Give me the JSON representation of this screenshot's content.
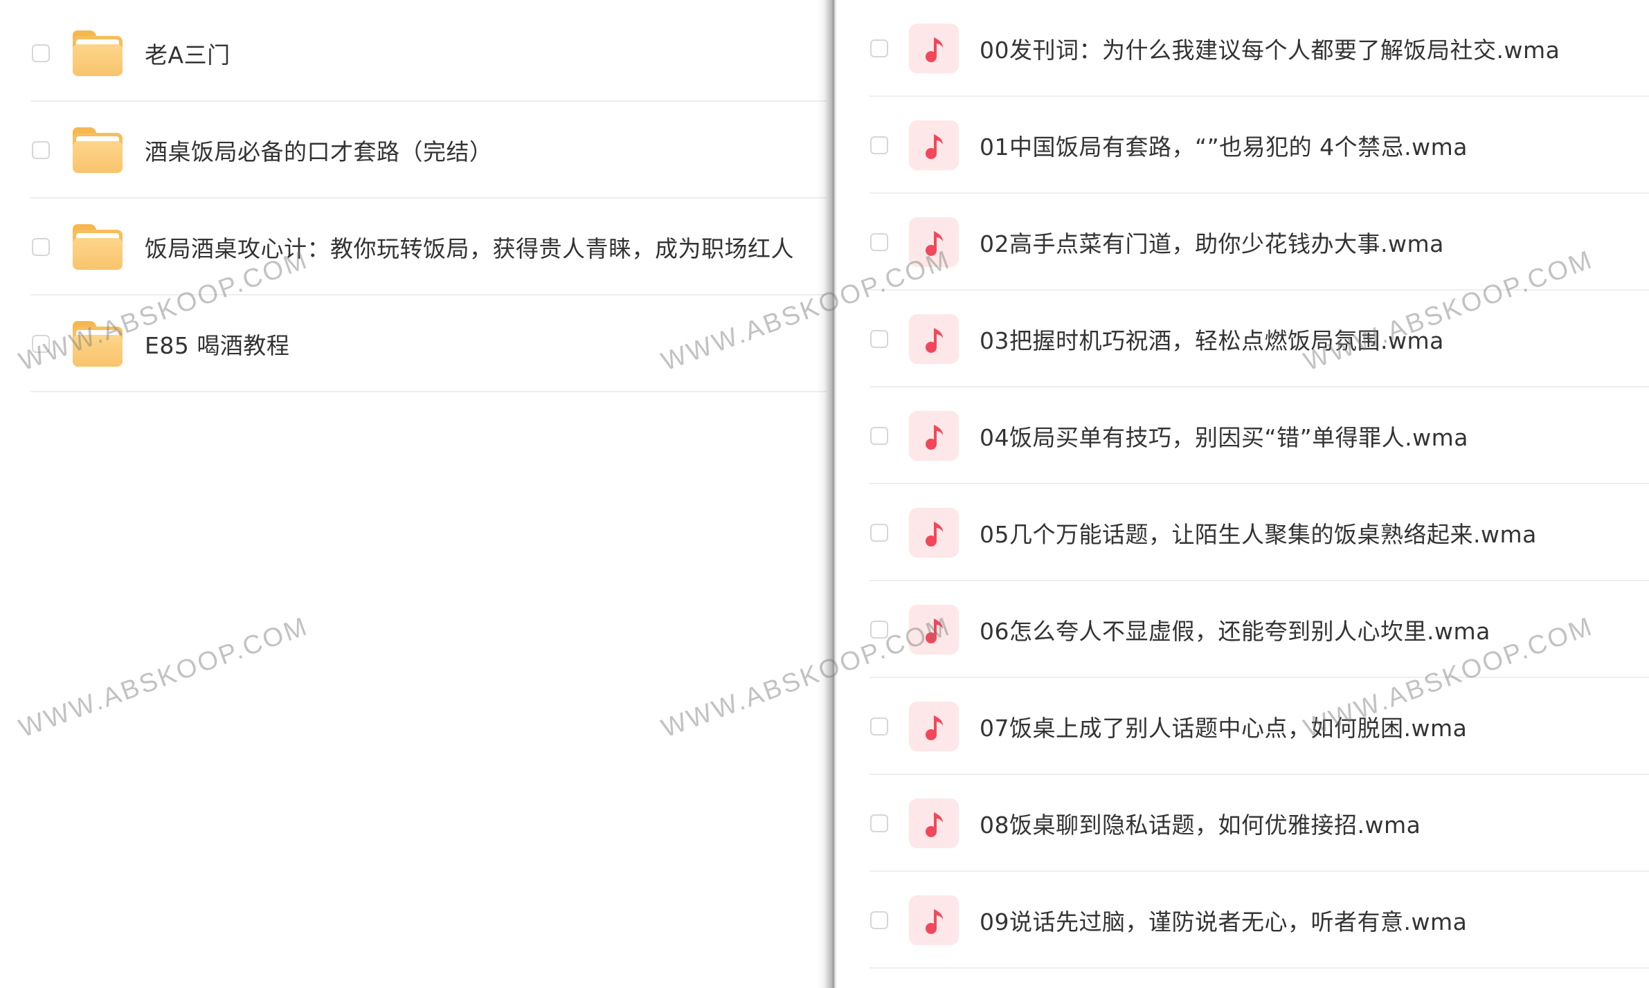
{
  "watermark_text": "WWW.ABSKOOP.COM",
  "left_panel": {
    "folders": [
      {
        "name": "老A三门"
      },
      {
        "name": "酒桌饭局必备的口才套路（完结）"
      },
      {
        "name": "饭局酒桌攻心计：教你玩转饭局，获得贵人青睐，成为职场红人"
      },
      {
        "name": "E85 喝酒教程"
      }
    ]
  },
  "right_panel": {
    "files": [
      {
        "name": "00发刊词：为什么我建议每个人都要了解饭局社交.wma"
      },
      {
        "name": "01中国饭局有套路，“”也易犯的 4个禁忌.wma"
      },
      {
        "name": "02高手点菜有门道，助你少花钱办大事.wma"
      },
      {
        "name": "03把握时机巧祝酒，轻松点燃饭局氛围.wma"
      },
      {
        "name": "04饭局买单有技巧，别因买“错”单得罪人.wma"
      },
      {
        "name": "05几个万能话题，让陌生人聚集的饭桌熟络起来.wma"
      },
      {
        "name": "06怎么夸人不显虚假，还能夸到别人心坎里.wma"
      },
      {
        "name": "07饭桌上成了别人话题中心点，如何脱困.wma"
      },
      {
        "name": "08饭桌聊到隐私话题，如何优雅接招.wma"
      },
      {
        "name": "09说话先过脑，谨防说者无心，听者有意.wma"
      }
    ]
  },
  "colors": {
    "folder": "#f6be5c",
    "music_bg": "#fde7e8",
    "music_note": "#f0485a",
    "text": "#333333",
    "separator": "#eeeeee"
  },
  "icons": {
    "folder": "folder-icon",
    "music": "music-file-icon"
  }
}
